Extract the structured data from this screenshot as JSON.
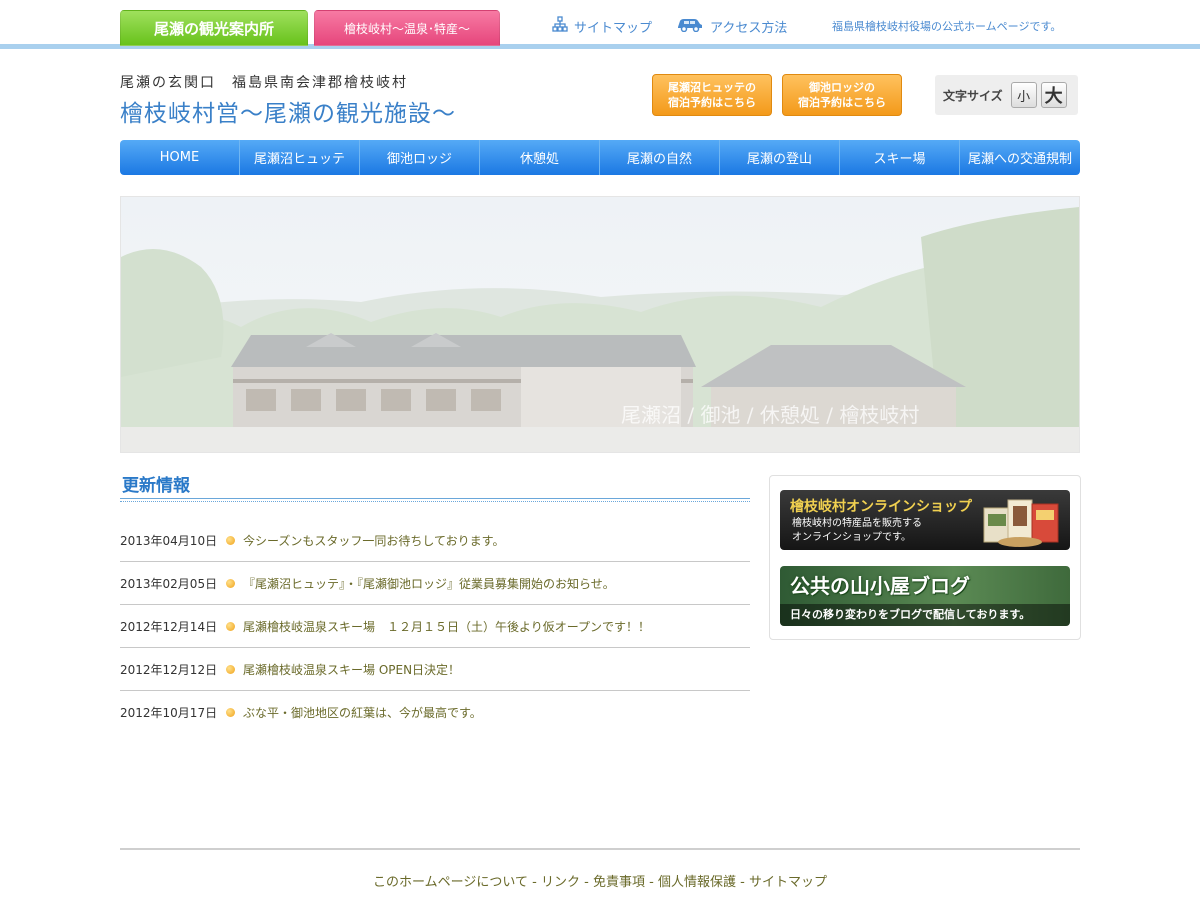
{
  "top": {
    "tab_primary": "尾瀬の観光案内所",
    "tab_secondary": "檜枝岐村～温泉･特産～",
    "sitemap_link": "サイトマップ",
    "access_link": "アクセス方法",
    "official_notice": "福島県檜枝岐村役場の公式ホームページです。"
  },
  "header": {
    "subtitle": "尾瀬の玄関口　福島県南会津郡檜枝岐村",
    "title": "檜枝岐村営～尾瀬の観光施設～",
    "booking_hutte_line1": "尾瀬沼ヒュッテの",
    "booking_hutte_line2": "宿泊予約はこちら",
    "booking_lodge_line1": "御池ロッジの",
    "booking_lodge_line2": "宿泊予約はこちら",
    "font_size_label": "文字サイズ",
    "font_small": "小",
    "font_large": "大"
  },
  "nav": {
    "items": [
      {
        "label": "HOME"
      },
      {
        "label": "尾瀬沼ヒュッテ"
      },
      {
        "label": "御池ロッジ"
      },
      {
        "label": "休憩処"
      },
      {
        "label": "尾瀬の自然"
      },
      {
        "label": "尾瀬の登山"
      },
      {
        "label": "スキー場"
      },
      {
        "label": "尾瀬への交通規制"
      }
    ]
  },
  "hero": {
    "overlay_text": "尾瀬沼 / 御池 / 休憩処 / 檜枝岐村"
  },
  "news": {
    "heading": "更新情報",
    "items": [
      {
        "date": "2013年04月10日",
        "text": "今シーズンもスタッフ一同お待ちしております。"
      },
      {
        "date": "2013年02月05日",
        "text": "『尾瀬沼ヒュッテ』・『尾瀬御池ロッジ』従業員募集開始のお知らせ。"
      },
      {
        "date": "2012年12月14日",
        "text": "尾瀬檜枝岐温泉スキー場　１２月１５日（土）午後より仮オープンです！！"
      },
      {
        "date": "2012年12月12日",
        "text": "尾瀬檜枝岐温泉スキー場 OPEN日決定！"
      },
      {
        "date": "2012年10月17日",
        "text": "ぶな平・御池地区の紅葉は、今が最高です。"
      }
    ]
  },
  "side": {
    "shop_title": "檜枝岐村オンラインショップ",
    "shop_desc_line1": "檜枝岐村の特産品を販売する",
    "shop_desc_line2": "オンラインショップです。",
    "blog_title": "公共の山小屋ブログ",
    "blog_desc": "日々の移り変わりをブログで配信しております。"
  },
  "footer": {
    "links": [
      {
        "label": "このホームページについて"
      },
      {
        "label": "リンク"
      },
      {
        "label": "免責事項"
      },
      {
        "label": "個人情報保護"
      },
      {
        "label": "サイトマップ"
      }
    ],
    "separator": " - "
  },
  "colors": {
    "accent_blue": "#2a79c8",
    "nav_blue": "#1b78e3",
    "tab_green": "#68c21c",
    "tab_pink": "#e6467c",
    "booking_orange": "#f39a1a",
    "news_text": "#6a6a2a"
  },
  "icons": {
    "sitemap": "sitemap-icon",
    "access": "car-icon"
  }
}
